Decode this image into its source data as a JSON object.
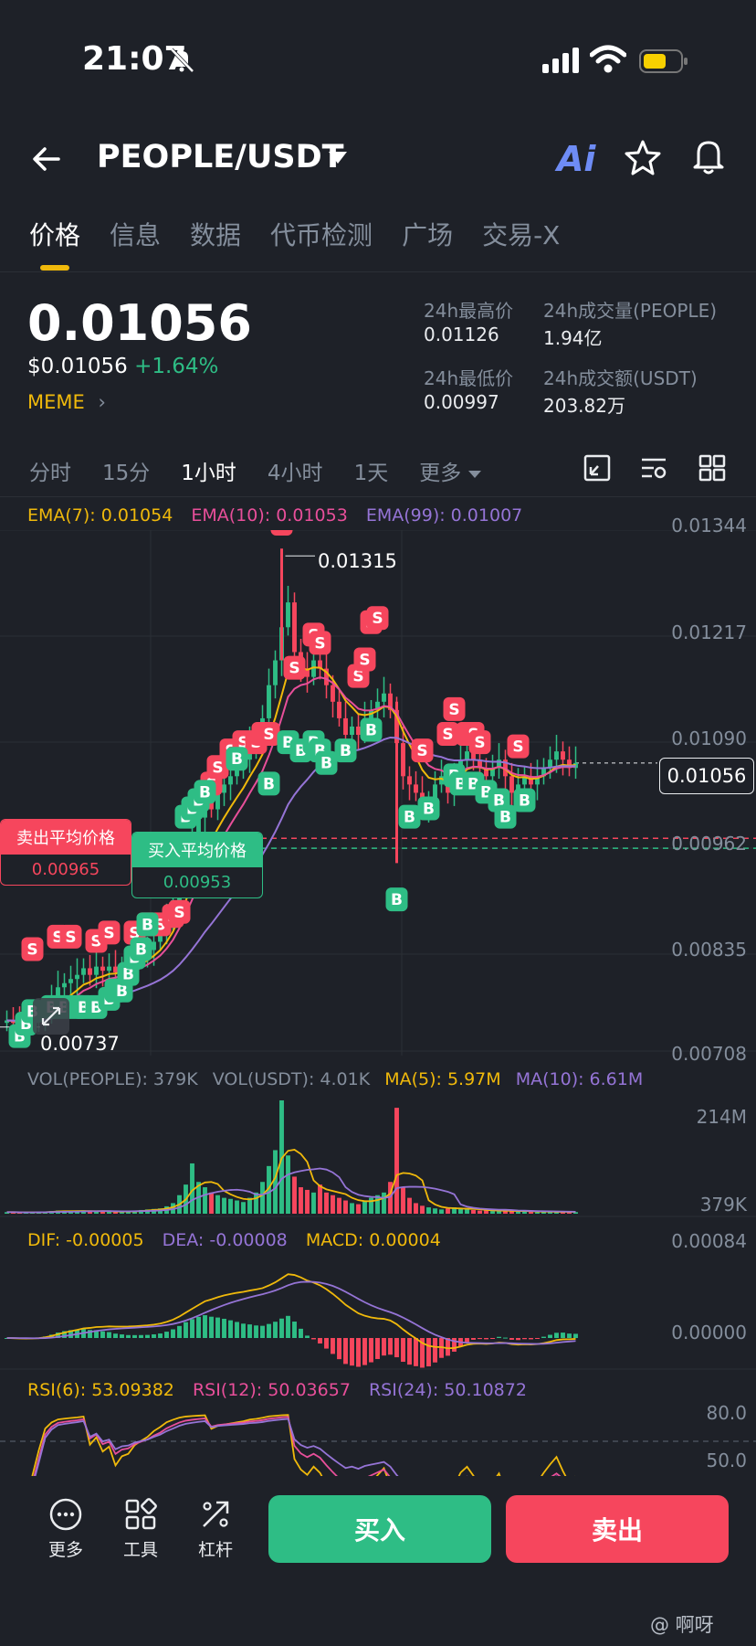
{
  "status_bar": {
    "time": "21:07"
  },
  "header": {
    "pair": "PEOPLE/USDT",
    "ai_label": "Ai"
  },
  "tabs": [
    "价格",
    "信息",
    "数据",
    "代币检测",
    "广场",
    "交易-X"
  ],
  "price": {
    "last": "0.01056",
    "usd": "$0.01056",
    "change": "+1.64%",
    "tag": "MEME",
    "high_label": "24h最高价",
    "high": "0.01126",
    "vol_base_label": "24h成交量(PEOPLE)",
    "vol_base": "1.94亿",
    "low_label": "24h最低价",
    "low": "0.00997",
    "vol_quote_label": "24h成交额(USDT)",
    "vol_quote": "203.82万"
  },
  "intervals": {
    "items": [
      "分时",
      "15分",
      "1小时",
      "4小时",
      "1天"
    ],
    "more": "更多",
    "active": "1小时"
  },
  "chart_data": {
    "type": "candlestick",
    "ema": {
      "ema7": "EMA(7): 0.01054",
      "ema10": "EMA(10): 0.01053",
      "ema99": "EMA(99): 0.01007"
    },
    "y_ticks": [
      "0.01344",
      "0.01217",
      "0.01090",
      "0.00962",
      "0.00835",
      "0.00708"
    ],
    "high_marker": "0.01315",
    "low_marker": "0.00737",
    "current_price_tag": "0.01056",
    "avg_sell_label": "卖出平均价格",
    "avg_sell": "0.00965",
    "avg_buy_label": "买入平均价格",
    "avg_buy": "0.00953",
    "buy_marker": "B",
    "sell_marker": "S",
    "close": [
      0.00745,
      0.00742,
      0.0074,
      0.00741,
      0.00744,
      0.00748,
      0.0076,
      0.00772,
      0.00785,
      0.0079,
      0.00795,
      0.008,
      0.00808,
      0.008,
      0.0081,
      0.00805,
      0.0081,
      0.00803,
      0.0081,
      0.00812,
      0.0082,
      0.00825,
      0.0083,
      0.0084,
      0.0085,
      0.0087,
      0.0089,
      0.0092,
      0.0095,
      0.0097,
      0.0099,
      0.0101,
      0.01,
      0.0102,
      0.0103,
      0.0104,
      0.0105,
      0.0106,
      0.0108,
      0.0109,
      0.0111,
      0.0115,
      0.0118,
      0.0122,
      0.0125,
      0.0119,
      0.0117,
      0.0116,
      0.0118,
      0.0117,
      0.0115,
      0.0113,
      0.0111,
      0.0109,
      0.011,
      0.0109,
      0.0111,
      0.0112,
      0.0113,
      0.0114,
      0.0112,
      0.0108,
      0.0104,
      0.0103,
      0.0102,
      0.01,
      0.0101,
      0.0103,
      0.0104,
      0.0102,
      0.0104,
      0.0106,
      0.0107,
      0.0106,
      0.0105,
      0.0104,
      0.0105,
      0.0106,
      0.0104,
      0.0102,
      0.0103,
      0.0104,
      0.0103,
      0.0104,
      0.0105,
      0.0106,
      0.0107,
      0.0106,
      0.0105,
      0.01056
    ],
    "volume": {
      "label_base": "VOL(PEOPLE): 379K",
      "label_quote": "VOL(USDT): 4.01K",
      "ma5": "MA(5): 5.97M",
      "ma10": "MA(10): 6.61M",
      "ticks": [
        "214M",
        "379K"
      ],
      "values": [
        3,
        3,
        2,
        2,
        3,
        3,
        4,
        5,
        6,
        5,
        4,
        5,
        6,
        5,
        4,
        5,
        4,
        3,
        4,
        5,
        6,
        7,
        8,
        9,
        10,
        14,
        20,
        35,
        55,
        95,
        60,
        50,
        40,
        35,
        30,
        28,
        25,
        22,
        30,
        40,
        60,
        90,
        120,
        214,
        110,
        70,
        50,
        45,
        40,
        55,
        40,
        35,
        30,
        25,
        20,
        18,
        25,
        30,
        35,
        40,
        60,
        200,
        50,
        30,
        20,
        15,
        12,
        10,
        8,
        10,
        12,
        9,
        8,
        7,
        6,
        6,
        5,
        5,
        6,
        5,
        4,
        5,
        4,
        3,
        4,
        4,
        3,
        3,
        4,
        3
      ]
    },
    "macd": {
      "dif": "DIF: -0.00005",
      "dea": "DEA: -0.00008",
      "macd": "MACD: 0.00004",
      "ticks": [
        "0.00084",
        "0.00000"
      ]
    },
    "rsi": {
      "rsi6": "RSI(6): 53.09382",
      "rsi12": "RSI(12): 50.03657",
      "rsi24": "RSI(24): 50.10872",
      "ticks": [
        "80.0",
        "50.0"
      ]
    }
  },
  "bottom": {
    "more": "更多",
    "tools": "工具",
    "leverage": "杠杆",
    "buy": "买入",
    "sell": "卖出"
  },
  "watermark": "@ 啊呀",
  "colors": {
    "up": "#2ebd85",
    "down": "#f6465d",
    "accent": "#f0b90b",
    "ema10": "#e84f9a",
    "ema99": "#9574d6"
  }
}
